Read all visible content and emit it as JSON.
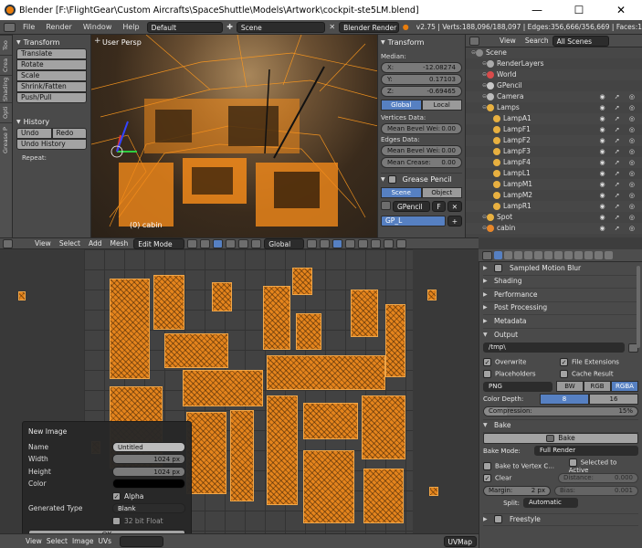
{
  "window": {
    "title": "Blender [F:\\FlightGear\\Custom Aircrafts\\SpaceShuttle\\Models\\Artwork\\cockpit-ste5LM.blend]",
    "minimize": "—",
    "maximize": "☐",
    "close": "✕"
  },
  "infobar": {
    "menus": [
      "File",
      "Render",
      "Window",
      "Help"
    ],
    "layout": "Default",
    "scene": "Scene",
    "engine": "Blender Render",
    "stats": "v2.75 | Verts:188,096/188,097 | Edges:356,666/356,669 | Faces:1"
  },
  "tabs": [
    "Too",
    "Crea",
    "Shading",
    "Opti",
    "Grease P"
  ],
  "toolshelf": {
    "transform_title": "Transform",
    "transform_buttons": [
      "Translate",
      "Rotate",
      "Scale",
      "Shrink/Fatten",
      "Push/Pull"
    ],
    "history_title": "History",
    "undo": "Undo",
    "redo": "Redo",
    "undo_history": "Undo History",
    "repeat_label": "Repeat:"
  },
  "viewport": {
    "label": "User Persp",
    "object_label": "(0) cabin"
  },
  "npanel": {
    "title": "Transform",
    "median_label": "Median:",
    "x_label": "X:",
    "x_value": "-12.08274",
    "y_label": "Y:",
    "y_value": "0.17103",
    "z_label": "Z:",
    "z_value": "-0.69465",
    "global": "Global",
    "local": "Local",
    "vertices_data": "Vertices Data:",
    "mean_bevel_label": "Mean Bevel Wei:",
    "mean_bevel_vertex": "0.00",
    "edges_data": "Edges Data:",
    "mean_bevel_edge": "0.00",
    "mean_crease_label": "Mean Crease:",
    "mean_crease": "0.00",
    "grease_title": "Grease Pencil",
    "scene_tab": "Scene",
    "object_tab": "Object",
    "gpencil": "GPencil",
    "f_label": "F",
    "gp_layer": "GP_L"
  },
  "outliner": {
    "view": "View",
    "search": "Search",
    "filter": "All Scenes",
    "rows": [
      {
        "label": "Scene",
        "indent": 0,
        "color": "#8a8a8a"
      },
      {
        "label": "RenderLayers",
        "indent": 1,
        "color": "#aaaaaa"
      },
      {
        "label": "World",
        "indent": 1,
        "color": "#d84b4b"
      },
      {
        "label": "GPencil",
        "indent": 1,
        "color": "#c8c8c8"
      },
      {
        "label": "Camera",
        "indent": 1,
        "color": "#bbbbbb"
      },
      {
        "label": "Lamps",
        "indent": 1,
        "color": "#e8b040"
      },
      {
        "label": "LampA1",
        "indent": 2,
        "color": "#e8b040"
      },
      {
        "label": "LampF1",
        "indent": 2,
        "color": "#e8b040"
      },
      {
        "label": "LampF2",
        "indent": 2,
        "color": "#e8b040"
      },
      {
        "label": "LampF3",
        "indent": 2,
        "color": "#e8b040"
      },
      {
        "label": "LampF4",
        "indent": 2,
        "color": "#e8b040"
      },
      {
        "label": "LampL1",
        "indent": 2,
        "color": "#e8b040"
      },
      {
        "label": "LampM1",
        "indent": 2,
        "color": "#e8b040"
      },
      {
        "label": "LampM2",
        "indent": 2,
        "color": "#e8b040"
      },
      {
        "label": "LampR1",
        "indent": 2,
        "color": "#e8b040"
      },
      {
        "label": "Spot",
        "indent": 1,
        "color": "#e8b040"
      },
      {
        "label": "cabin",
        "indent": 1,
        "color": "#e8872a"
      }
    ]
  },
  "midbar": {
    "view": "View",
    "select": "Select",
    "add": "Add",
    "mesh": "Mesh",
    "mode": "Edit Mode",
    "orientation": "Global"
  },
  "dialog": {
    "title": "New Image",
    "name_label": "Name",
    "name_value": "Untitled",
    "width_label": "Width",
    "width_value": "1024 px",
    "height_label": "Height",
    "height_value": "1024 px",
    "color_label": "Color",
    "alpha_label": "Alpha",
    "generated_label": "Generated Type",
    "generated_value": "Blank",
    "float_label": "32 bit Float",
    "ok": "OK"
  },
  "bottombar": {
    "view": "View",
    "select": "Select",
    "image": "Image",
    "uvs": "UVs",
    "uvmap": "UVMap"
  },
  "props": {
    "sections": [
      {
        "label": "Sampled Motion Blur",
        "checkbox": true
      },
      {
        "label": "Shading"
      },
      {
        "label": "Performance"
      },
      {
        "label": "Post Processing"
      },
      {
        "label": "Metadata"
      }
    ],
    "output_title": "Output",
    "output_path": "/tmp\\",
    "overwrite": "Overwrite",
    "file_extensions": "File Extensions",
    "placeholders": "Placeholders",
    "cache_result": "Cache Result",
    "format": "PNG",
    "bw": "BW",
    "rgb": "RGB",
    "rgba": "RGBA",
    "color_depth_label": "Color Depth:",
    "depth_8": "8",
    "depth_16": "16",
    "compression_label": "Compression:",
    "compression_value": "15%",
    "compression_fraction": 0.15,
    "bake_title": "Bake",
    "bake_button": "Bake",
    "bake_mode_label": "Bake Mode:",
    "bake_mode_value": "Full Render",
    "bake_to_vertex": "Bake to Vertex C...",
    "selected_to_active": "Selected to Active",
    "clear": "Clear",
    "distance_label": "Distance:",
    "distance_value": "0.000",
    "margin_label": "Margin:",
    "margin_value": "2 px",
    "bias_label": "Bias:",
    "bias_value": "0.001",
    "split_label": "Split:",
    "split_value": "Automatic",
    "freestyle_title": "Freestyle"
  },
  "colors": {
    "accent": "#5680c2",
    "uv_orange": "#f28a1a"
  }
}
